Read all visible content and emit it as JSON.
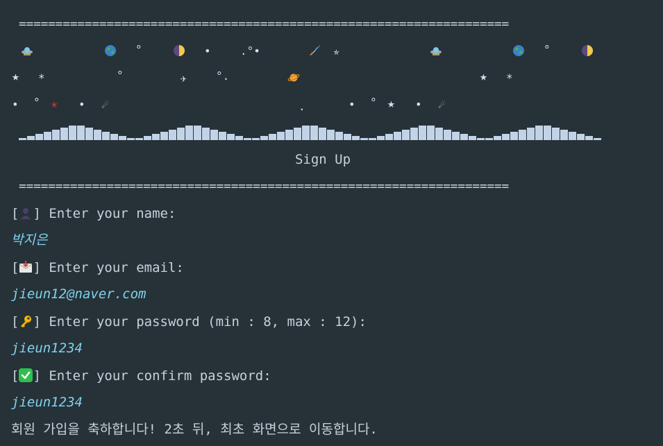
{
  "separator": "===================================================================",
  "title": "Sign Up",
  "prompts": {
    "name": "Enter your name:",
    "email": "Enter your email:",
    "password": "Enter your password (min : 8, max : 12):",
    "confirm": "Enter your confirm password:"
  },
  "inputs": {
    "name": "박지은",
    "email": "jieun12@naver.com",
    "password": "jieun1234",
    "confirm": "jieun1234"
  },
  "message": "회원 가입을 축하합니다! 2초 뒤, 최초 화면으로 이동합니다.",
  "bracket_open": "[",
  "bracket_close": "]",
  "icons": [
    "person-icon",
    "envelope-icon",
    "key-icon",
    "check-icon",
    "ufo-icon",
    "earth-icon",
    "moon-icon",
    "rocket-icon",
    "star-icon",
    "planet-icon",
    "comet-icon"
  ],
  "colors": {
    "background": "#263238",
    "text": "#c9d1d9",
    "input": "#7fd3ee",
    "wave": "#c3d3e7"
  }
}
